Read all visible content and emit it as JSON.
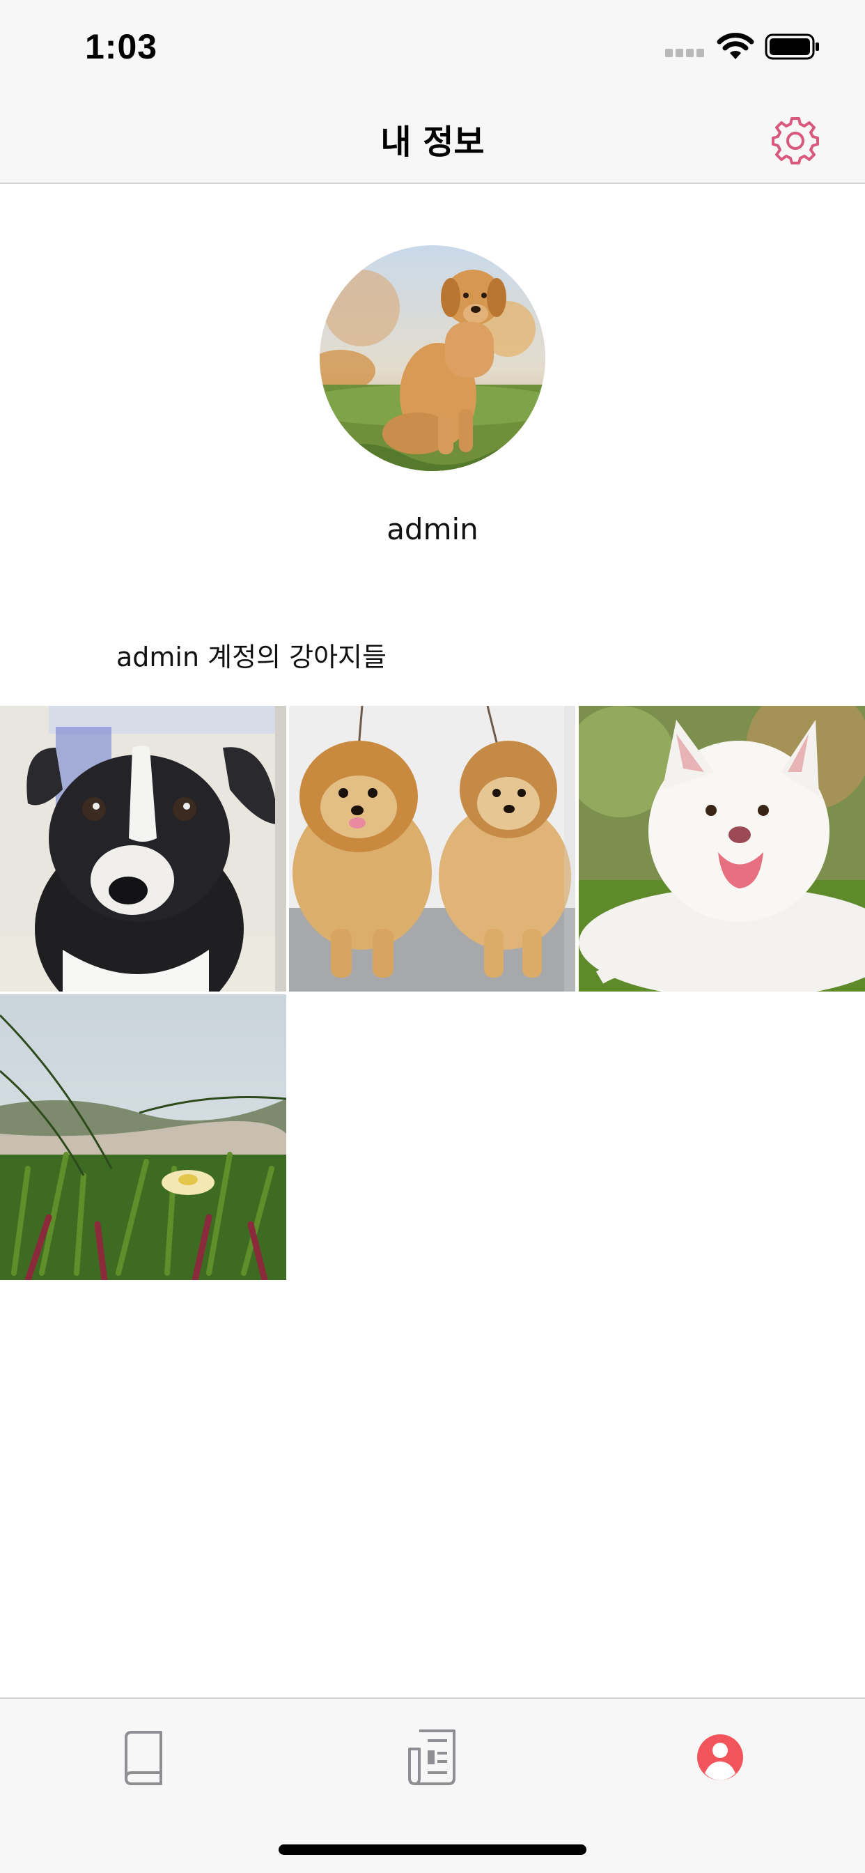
{
  "status_bar": {
    "time": "1:03"
  },
  "nav": {
    "title": "내 정보",
    "settings_icon": "gear-icon",
    "accent_color": "#d9587d"
  },
  "profile": {
    "username": "admin",
    "avatar_icon": "golden-retriever-photo"
  },
  "gallery": {
    "title": "admin 계정의 강아지들",
    "photos": [
      {
        "subject": "black-white-puppy-photo"
      },
      {
        "subject": "two-pomeranians-photo"
      },
      {
        "subject": "white-samoyed-photo"
      },
      {
        "subject": "ice-plant-flower-photo"
      }
    ]
  },
  "tab_bar": {
    "tabs": [
      {
        "icon": "book-icon",
        "selected": false
      },
      {
        "icon": "newspaper-icon",
        "selected": false
      },
      {
        "icon": "profile-icon",
        "selected": true
      }
    ],
    "inactive_color": "#8e8e93",
    "active_color": "#f2545b"
  }
}
